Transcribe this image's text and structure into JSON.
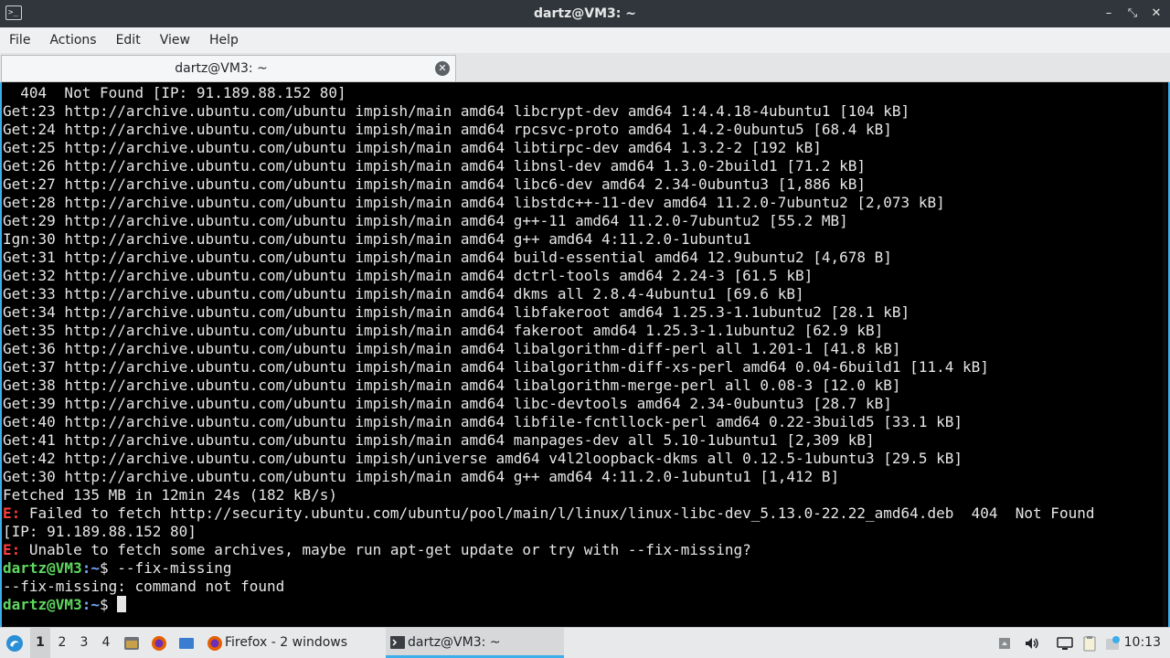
{
  "window": {
    "title": "dartz@VM3: ~",
    "app_icon_glyph": ">_"
  },
  "menu": [
    "File",
    "Actions",
    "Edit",
    "View",
    "Help"
  ],
  "tab": {
    "label": "dartz@VM3: ~"
  },
  "terminal": {
    "lines": [
      {
        "text": "  404  Not Found [IP: 91.189.88.152 80]"
      },
      {
        "text": "Get:23 http://archive.ubuntu.com/ubuntu impish/main amd64 libcrypt-dev amd64 1:4.4.18-4ubuntu1 [104 kB]"
      },
      {
        "text": "Get:24 http://archive.ubuntu.com/ubuntu impish/main amd64 rpcsvc-proto amd64 1.4.2-0ubuntu5 [68.4 kB]"
      },
      {
        "text": "Get:25 http://archive.ubuntu.com/ubuntu impish/main amd64 libtirpc-dev amd64 1.3.2-2 [192 kB]"
      },
      {
        "text": "Get:26 http://archive.ubuntu.com/ubuntu impish/main amd64 libnsl-dev amd64 1.3.0-2build1 [71.2 kB]"
      },
      {
        "text": "Get:27 http://archive.ubuntu.com/ubuntu impish/main amd64 libc6-dev amd64 2.34-0ubuntu3 [1,886 kB]"
      },
      {
        "text": "Get:28 http://archive.ubuntu.com/ubuntu impish/main amd64 libstdc++-11-dev amd64 11.2.0-7ubuntu2 [2,073 kB]"
      },
      {
        "text": "Get:29 http://archive.ubuntu.com/ubuntu impish/main amd64 g++-11 amd64 11.2.0-7ubuntu2 [55.2 MB]"
      },
      {
        "text": "Ign:30 http://archive.ubuntu.com/ubuntu impish/main amd64 g++ amd64 4:11.2.0-1ubuntu1"
      },
      {
        "text": "Get:31 http://archive.ubuntu.com/ubuntu impish/main amd64 build-essential amd64 12.9ubuntu2 [4,678 B]"
      },
      {
        "text": "Get:32 http://archive.ubuntu.com/ubuntu impish/main amd64 dctrl-tools amd64 2.24-3 [61.5 kB]"
      },
      {
        "text": "Get:33 http://archive.ubuntu.com/ubuntu impish/main amd64 dkms all 2.8.4-4ubuntu1 [69.6 kB]"
      },
      {
        "text": "Get:34 http://archive.ubuntu.com/ubuntu impish/main amd64 libfakeroot amd64 1.25.3-1.1ubuntu2 [28.1 kB]"
      },
      {
        "text": "Get:35 http://archive.ubuntu.com/ubuntu impish/main amd64 fakeroot amd64 1.25.3-1.1ubuntu2 [62.9 kB]"
      },
      {
        "text": "Get:36 http://archive.ubuntu.com/ubuntu impish/main amd64 libalgorithm-diff-perl all 1.201-1 [41.8 kB]"
      },
      {
        "text": "Get:37 http://archive.ubuntu.com/ubuntu impish/main amd64 libalgorithm-diff-xs-perl amd64 0.04-6build1 [11.4 kB]"
      },
      {
        "text": "Get:38 http://archive.ubuntu.com/ubuntu impish/main amd64 libalgorithm-merge-perl all 0.08-3 [12.0 kB]"
      },
      {
        "text": "Get:39 http://archive.ubuntu.com/ubuntu impish/main amd64 libc-devtools amd64 2.34-0ubuntu3 [28.7 kB]"
      },
      {
        "text": "Get:40 http://archive.ubuntu.com/ubuntu impish/main amd64 libfile-fcntllock-perl amd64 0.22-3build5 [33.1 kB]"
      },
      {
        "text": "Get:41 http://archive.ubuntu.com/ubuntu impish/main amd64 manpages-dev all 5.10-1ubuntu1 [2,309 kB]"
      },
      {
        "text": "Get:42 http://archive.ubuntu.com/ubuntu impish/universe amd64 v4l2loopback-dkms all 0.12.5-1ubuntu3 [29.5 kB]"
      },
      {
        "text": "Get:30 http://archive.ubuntu.com/ubuntu impish/main amd64 g++ amd64 4:11.2.0-1ubuntu1 [1,412 B]"
      },
      {
        "text": "Fetched 135 MB in 12min 24s (182 kB/s)"
      },
      {
        "err": "E:",
        "text": " Failed to fetch http://security.ubuntu.com/ubuntu/pool/main/l/linux/linux-libc-dev_5.13.0-22.22_amd64.deb  404  Not Found"
      },
      {
        "text": "[IP: 91.189.88.152 80]"
      },
      {
        "err": "E:",
        "text": " Unable to fetch some archives, maybe run apt-get update or try with --fix-missing?"
      },
      {
        "user": "dartz@VM3",
        "path": ":~",
        "text": "$ --fix-missing"
      },
      {
        "text": "--fix-missing: command not found"
      },
      {
        "user": "dartz@VM3",
        "path": ":~",
        "text": "$ ",
        "cursor": true
      }
    ]
  },
  "taskbar": {
    "desktops": [
      "1",
      "2",
      "3",
      "4"
    ],
    "active_desktop": "1",
    "tasks": [
      {
        "label": "Firefox - 2 windows",
        "icon": "firefox-icon"
      },
      {
        "label": "dartz@VM3: ~",
        "icon": "terminal-icon"
      }
    ],
    "clock": "10:13",
    "colors": {
      "accent": "#3daee9",
      "firefox": "#e66000",
      "prompt": "#5fd75f",
      "error": "#ff3c3c"
    }
  }
}
